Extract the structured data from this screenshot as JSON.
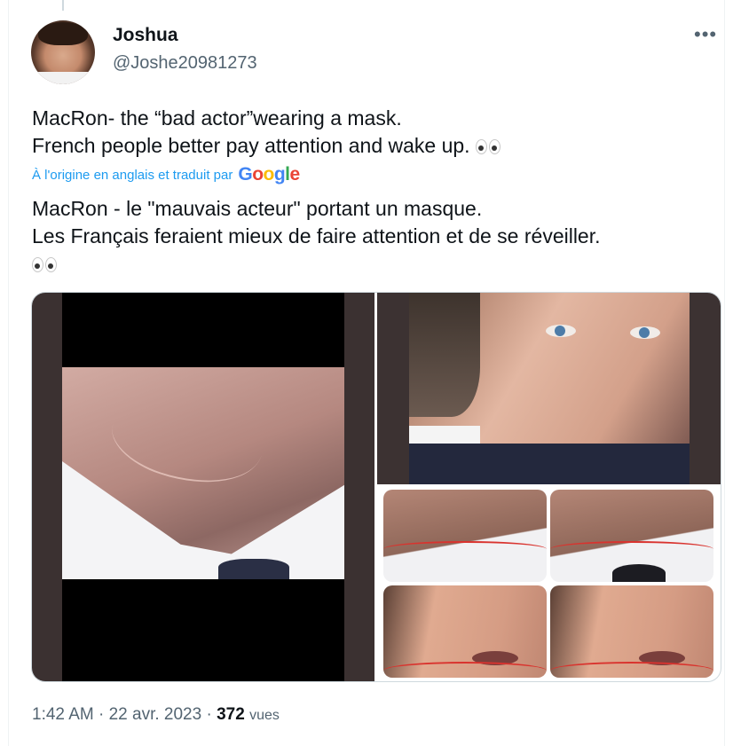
{
  "author": {
    "name": "Joshua",
    "handle": "@Joshe20981273"
  },
  "tweet": {
    "original_lines": [
      "MacRon- the “bad actor”wearing a mask.",
      "French people better pay attention and wake up."
    ],
    "translation_note": "À l'origine en anglais et traduit par",
    "translation_brand": "Google",
    "translated_lines": [
      "MacRon - le \"mauvais acteur\" portant un masque.",
      "Les Français feraient mieux de faire attention et de se réveiller."
    ],
    "emoji": "eyes-emoji"
  },
  "media": {
    "images": [
      "neck-scar-closeup",
      "face-closeup",
      "neck-crop-annotated-1",
      "neck-crop-annotated-2",
      "mouth-crop-annotated-1",
      "mouth-crop-annotated-2"
    ]
  },
  "meta": {
    "time": "1:42 AM",
    "separator": "·",
    "date": "22 avr. 2023",
    "views_count": "372",
    "views_label": "vues"
  },
  "more_icon": "more-options-icon",
  "colors": {
    "link": "#1d9bf0",
    "secondary_text": "#536471",
    "primary_text": "#0f1419"
  }
}
